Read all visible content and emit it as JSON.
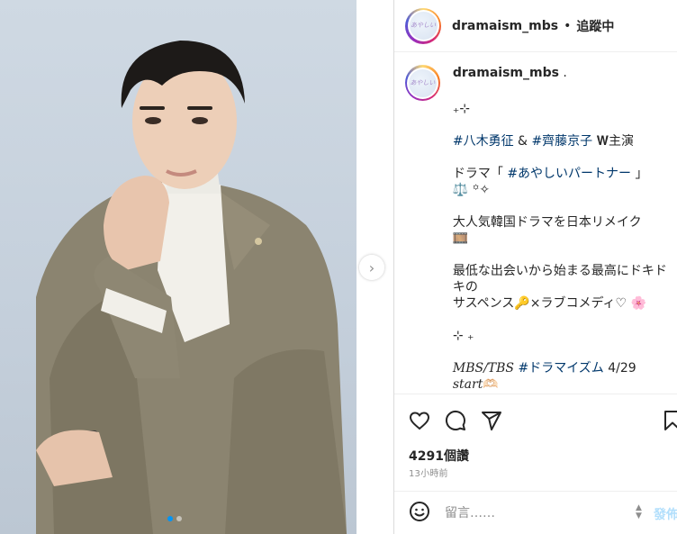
{
  "post": {
    "username": "dramaism_mbs",
    "separator": "•",
    "follow_status": "追蹤中",
    "avatar_text": "あやしい",
    "carousel_next_label": "›",
    "carousel_pages": 2,
    "carousel_current": 1
  },
  "caption": {
    "username": "dramaism_mbs",
    "username_suffix": " .",
    "lines": [
      {
        "parts": [
          {
            "t": "₊⊹"
          }
        ]
      },
      {
        "parts": []
      },
      {
        "parts": [
          {
            "t": "#八木勇征",
            "tag": true
          },
          {
            "t": " & "
          },
          {
            "t": "#齊藤京子",
            "tag": true
          },
          {
            "t": " 𝐖主演"
          }
        ]
      },
      {
        "parts": []
      },
      {
        "parts": [
          {
            "t": "ドラマ「 "
          },
          {
            "t": "#あやしいパートナー",
            "tag": true
          },
          {
            "t": " 」"
          }
        ]
      },
      {
        "parts": [
          {
            "t": "⚖️ ꙳✧"
          }
        ]
      },
      {
        "parts": []
      },
      {
        "parts": [
          {
            "t": "大人気韓国ドラマを日本リメイク"
          }
        ]
      },
      {
        "parts": [
          {
            "t": "🎞️"
          }
        ]
      },
      {
        "parts": []
      },
      {
        "parts": [
          {
            "t": "最低な出会いから始まる最高にドキドキの"
          }
        ]
      },
      {
        "parts": [
          {
            "t": "サスペンス🔑×ラブコメディ♡ 🌸"
          }
        ]
      },
      {
        "parts": []
      },
      {
        "parts": [
          {
            "t": "⊹ ₊"
          }
        ]
      },
      {
        "parts": []
      },
      {
        "parts": [
          {
            "t": "MBS/TBS ",
            "serif": true
          },
          {
            "t": "#ドラマイズム",
            "tag": true
          },
          {
            "t": " 4/29"
          }
        ]
      },
      {
        "parts": [
          {
            "t": "start",
            "serif": true
          },
          {
            "t": "🫶🏻"
          }
        ]
      }
    ]
  },
  "actions": {
    "like_icon": "heart-icon",
    "comment_icon": "comment-icon",
    "share_icon": "send-icon",
    "save_icon": "bookmark-icon"
  },
  "stats": {
    "likes": "4291個讚",
    "time_ago": "13小時前"
  },
  "comment": {
    "emoji_icon": "emoji-icon",
    "placeholder": "留言……",
    "stepper": "▲\n▼",
    "post_label": "發佈"
  },
  "colors": {
    "hashtag": "#00376b",
    "post_button_disabled": "#b2dffc",
    "carousel_dot_active": "#0095f6"
  }
}
